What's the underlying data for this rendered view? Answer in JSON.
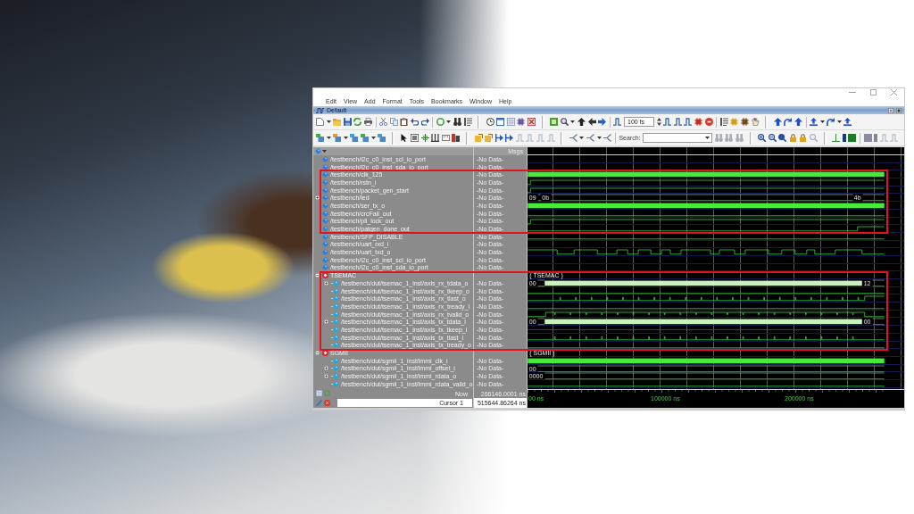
{
  "window": {
    "menu": [
      "Edit",
      "View",
      "Add",
      "Format",
      "Tools",
      "Bookmarks",
      "Window",
      "Help"
    ],
    "pane_title": "Default"
  },
  "toolbar": {
    "time_step": "100 fs",
    "search_label": "Search:"
  },
  "signal_list": {
    "value_header": "Msgs",
    "sections": [
      {
        "highlighted": false,
        "rows": [
          {
            "kind": "signal",
            "name": "/testbench/i2c_c0_inst_scl_io_port",
            "value": "-No Data-"
          },
          {
            "kind": "signal",
            "name": "/testbench/i2c_c0_inst_sda_io_port",
            "value": "-No Data-"
          }
        ]
      },
      {
        "highlighted": true,
        "rows": [
          {
            "kind": "signal",
            "name": "/testbench/clk_125",
            "value": "-No Data-",
            "wave": {
              "kind": "clock"
            }
          },
          {
            "kind": "signal",
            "name": "/testbench/rstn_i",
            "value": "-No Data-",
            "wave": {
              "kind": "rise"
            }
          },
          {
            "kind": "signal",
            "name": "/testbench/packet_gen_start",
            "value": "-No Data-",
            "wave": {
              "kind": "rise"
            }
          },
          {
            "kind": "signal",
            "name": "/testbench/led",
            "value": "-No Data-",
            "expanded": false,
            "wave": {
              "kind": "bus",
              "labels": [
                "09",
                "0b",
                "4b"
              ]
            }
          },
          {
            "kind": "signal",
            "name": "/testbench/ser_tx_o",
            "value": "-No Data-",
            "wave": {
              "kind": "clock"
            }
          },
          {
            "kind": "signal",
            "name": "/testbench/crcFail_out",
            "value": "-No Data-",
            "wave": {
              "kind": "low"
            }
          },
          {
            "kind": "signal",
            "name": "/testbench/pll_lock_out",
            "value": "-No Data-",
            "wave": {
              "kind": "rise"
            }
          },
          {
            "kind": "signal",
            "name": "/testbench/patgen_done_out",
            "value": "-No Data-",
            "wave": {
              "kind": "late_rise"
            }
          }
        ]
      },
      {
        "highlighted": false,
        "rows": [
          {
            "kind": "signal",
            "name": "/testbench/SFP_DISABLE",
            "value": "-No Data-",
            "wave": {
              "kind": "low"
            }
          },
          {
            "kind": "signal",
            "name": "/testbench/uart_rxd_i",
            "value": "-No Data-"
          },
          {
            "kind": "signal",
            "name": "/testbench/uart_txd_o",
            "value": "-No Data-",
            "wave": {
              "kind": "serial"
            }
          },
          {
            "kind": "signal",
            "name": "/testbench/i2c_c0_inst_scl_io_port",
            "value": "-No Data-"
          },
          {
            "kind": "signal",
            "name": "/testbench/i2c_c0_inst_sda_io_port",
            "value": "-No Data-"
          }
        ]
      },
      {
        "highlighted": true,
        "rows": [
          {
            "kind": "group",
            "name": "TSEMAC",
            "expanded": true,
            "wave": {
              "kind": "group_label",
              "labels": [
                "( TSEMAC )"
              ]
            },
            "children": [
              {
                "kind": "port",
                "name": "/testbench/dut/tsemac_1_inst/axis_rx_tdata_o",
                "value": "-No Data-",
                "expanded": false,
                "wave": {
                  "kind": "burst",
                  "labels": [
                    "00",
                    "12"
                  ]
                }
              },
              {
                "kind": "port",
                "name": "/testbench/dut/tsemac_1_inst/axis_rx_tkeep_o",
                "value": "-No Data-",
                "wave": {
                  "kind": "low"
                }
              },
              {
                "kind": "port",
                "name": "/testbench/dut/tsemac_1_inst/axis_rx_tlast_o",
                "value": "-No Data-",
                "wave": {
                  "kind": "pulses_rise"
                }
              },
              {
                "kind": "port",
                "name": "/testbench/dut/tsemac_1_inst/axis_rx_tready_i",
                "value": "-No Data-",
                "wave": {
                  "kind": "low"
                }
              },
              {
                "kind": "port",
                "name": "/testbench/dut/tsemac_1_inst/axis_rx_tvalid_o",
                "value": "-No Data-",
                "wave": {
                  "kind": "high_dips"
                }
              },
              {
                "kind": "port",
                "name": "/testbench/dut/tsemac_1_inst/axis_tx_tdata_i",
                "value": "-No Data-",
                "expanded": false,
                "wave": {
                  "kind": "burst",
                  "labels": [
                    "00",
                    "00"
                  ]
                }
              },
              {
                "kind": "port",
                "name": "/testbench/dut/tsemac_1_inst/axis_tx_tkeep_i",
                "value": "-No Data-",
                "wave": {
                  "kind": "z"
                }
              },
              {
                "kind": "port",
                "name": "/testbench/dut/tsemac_1_inst/axis_tx_tlast_i",
                "value": "-No Data-",
                "wave": {
                  "kind": "pulses"
                }
              },
              {
                "kind": "port",
                "name": "/testbench/dut/tsemac_1_inst/axis_tx_tready_o",
                "value": "-No Data-",
                "wave": {
                  "kind": "low"
                }
              }
            ]
          }
        ]
      },
      {
        "highlighted": false,
        "rows": [
          {
            "kind": "group",
            "name": "SGMII",
            "expanded": true,
            "wave": {
              "kind": "group_label",
              "labels": [
                "( SGMII )"
              ]
            },
            "children": [
              {
                "kind": "port",
                "name": "/testbench/dut/sgmii_1_inst/lmmi_clk_i",
                "value": "-No Data-",
                "wave": {
                  "kind": "clock"
                }
              },
              {
                "kind": "port",
                "name": "/testbench/dut/sgmii_1_inst/lmmi_offset_i",
                "value": "-No Data-",
                "expanded": false,
                "wave": {
                  "kind": "bus",
                  "labels": [
                    "00"
                  ]
                }
              },
              {
                "kind": "port",
                "name": "/testbench/dut/sgmii_1_inst/lmmi_rdata_o",
                "value": "-No Data-",
                "expanded": false,
                "wave": {
                  "kind": "bus",
                  "labels": [
                    "0000"
                  ]
                }
              },
              {
                "kind": "port",
                "name": "/testbench/dut/sgmii_1_inst/lmmi_rdata_valid_o",
                "value": "-No Data-",
                "wave": {
                  "kind": "low"
                }
              }
            ]
          }
        ]
      }
    ]
  },
  "cursor_panel": {
    "now_label": "Now",
    "now_time": "266146.0001 ns",
    "cursor_label": "Cursor 1",
    "cursor_time": "515644.86264 ns"
  },
  "time_axis": {
    "labels": [
      "00 ns",
      "100000 ns",
      "200000 ns"
    ]
  }
}
